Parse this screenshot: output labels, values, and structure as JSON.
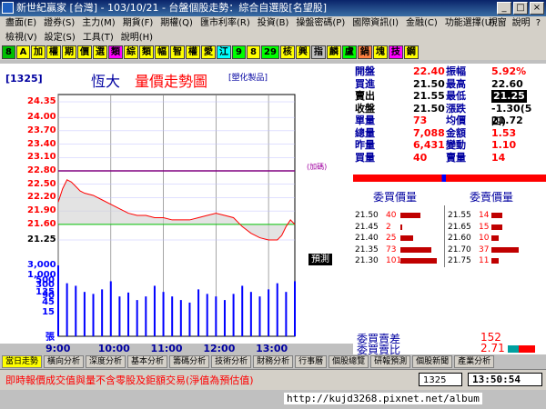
{
  "window": {
    "title": "新世紀贏家 [台灣] - 103/10/21 - 台盤個股走勢：綜合自選股[名望股]",
    "controls": [
      "_",
      "□",
      "×"
    ]
  },
  "menu": {
    "row1": [
      "盡面(E)",
      "證券(S)",
      "主力(M)",
      "期貨(F)",
      "期權(Q)",
      "匯市利率(R)",
      "投資(B)",
      "操盤密碼(P)",
      "國際資訊(I)",
      "金融(C)",
      "功能選擇(U)"
    ],
    "row2": [
      "檢視(V)",
      "設定(S)",
      "工具(T)",
      "說明(H)"
    ],
    "right_tools": [
      "視窗",
      "說明",
      "?"
    ]
  },
  "toolbar": {
    "buttons": [
      {
        "label": "8",
        "bg": "#00c000"
      },
      {
        "label": "A",
        "bg": "#ffff00"
      },
      {
        "label": "加",
        "bg": "#ffff00"
      },
      {
        "label": "權",
        "bg": "#ffff00"
      },
      {
        "label": "期",
        "bg": "#ffff00"
      },
      {
        "label": "價",
        "bg": "#ffff00"
      },
      {
        "label": "選",
        "bg": "#ffff00"
      },
      {
        "label": "類",
        "bg": "#ff00ff"
      },
      {
        "label": "綜",
        "bg": "#ffff00"
      },
      {
        "label": "類",
        "bg": "#ffff00"
      },
      {
        "label": "幅",
        "bg": "#ffff00"
      },
      {
        "label": "智",
        "bg": "#ffff00"
      },
      {
        "label": "權",
        "bg": "#ffff00"
      },
      {
        "label": "愛",
        "bg": "#ffff00"
      },
      {
        "label": "江",
        "bg": "#00ffff"
      },
      {
        "label": "9",
        "bg": "#00ff00"
      },
      {
        "label": "8",
        "bg": "#ffff00"
      },
      {
        "label": "29",
        "bg": "#00ff00"
      },
      {
        "label": "核",
        "bg": "#ffff00"
      },
      {
        "label": "興",
        "bg": "#ffff00"
      },
      {
        "label": "指",
        "bg": "#c0c0c0"
      },
      {
        "label": "麟",
        "bg": "#ffff00"
      },
      {
        "label": "盧",
        "bg": "#00ff00"
      },
      {
        "label": "鍋",
        "bg": "#ff8040"
      },
      {
        "label": "塊",
        "bg": "#ffff00"
      },
      {
        "label": "技",
        "bg": "#ff00ff"
      },
      {
        "label": "鋼",
        "bg": "#ffff00"
      }
    ]
  },
  "chart_header": {
    "code": "[1325]",
    "stock_name": "恆大",
    "title": "量價走勢圖",
    "tag": "[塑化製品]",
    "limit_label": "(加碼)",
    "yuce_label": "預測"
  },
  "colors": {
    "price_line": "#ff0000",
    "volume_bar": "#0000ff",
    "limit_line": "#800080",
    "ref_line": "#00c000",
    "label_red": "#ff0000",
    "label_blue": "#0000ff"
  },
  "chart_data": {
    "type": "line",
    "price_ticks": [
      "24.35",
      "24.00",
      "23.70",
      "23.40",
      "23.10",
      "22.80",
      "22.50",
      "22.20",
      "21.90",
      "21.60",
      "21.25"
    ],
    "volume_ticks": [
      "3,000",
      "1,000",
      "500",
      "300",
      "135",
      "90",
      "45",
      "15",
      "張"
    ],
    "x_ticks": [
      "9:00",
      "10:00",
      "11:00",
      "12:00",
      "13:00"
    ],
    "ylim": [
      21.25,
      24.35
    ],
    "limit_price": 22.8,
    "ref_price": 21.6,
    "price_x": [
      "09:00",
      "09:05",
      "09:10",
      "09:15",
      "09:20",
      "09:25",
      "09:30",
      "09:40",
      "09:50",
      "10:00",
      "10:10",
      "10:20",
      "10:30",
      "10:40",
      "10:50",
      "11:00",
      "11:10",
      "11:20",
      "11:30",
      "11:40",
      "11:50",
      "12:00",
      "12:10",
      "12:20",
      "12:30",
      "12:40",
      "12:50",
      "13:00",
      "13:10",
      "13:15",
      "13:20",
      "13:25",
      "13:30"
    ],
    "price_y": [
      22.1,
      22.4,
      22.6,
      22.55,
      22.45,
      22.35,
      22.3,
      22.25,
      22.15,
      22.05,
      21.95,
      21.85,
      21.8,
      21.8,
      21.75,
      21.75,
      21.7,
      21.7,
      21.7,
      21.75,
      21.8,
      21.85,
      21.8,
      21.75,
      21.55,
      21.4,
      21.3,
      21.25,
      21.25,
      21.35,
      21.55,
      21.7,
      21.6
    ],
    "volume_x": [
      "09:00",
      "09:10",
      "09:20",
      "09:30",
      "09:40",
      "09:50",
      "10:00",
      "10:10",
      "10:20",
      "10:30",
      "10:40",
      "10:50",
      "11:00",
      "11:10",
      "11:20",
      "11:30",
      "11:40",
      "11:50",
      "12:00",
      "12:10",
      "12:20",
      "12:30",
      "12:40",
      "12:50",
      "13:00",
      "13:10",
      "13:20",
      "13:30"
    ],
    "volume_y": [
      3000,
      400,
      300,
      150,
      120,
      200,
      500,
      90,
      140,
      60,
      90,
      300,
      150,
      90,
      60,
      45,
      200,
      120,
      90,
      60,
      120,
      300,
      150,
      90,
      200,
      400,
      150,
      500
    ]
  },
  "quote": {
    "rows": [
      {
        "l_label": "開盤",
        "l_val": "22.40",
        "l_color": "#ff0000",
        "r_label": "振幅",
        "r_val": "5.92%",
        "r_color": "#ff0000"
      },
      {
        "l_label": "買進",
        "l_val": "21.50",
        "l_color": "#000000",
        "r_label": "最高",
        "r_val": "22.60",
        "r_color": "#000000"
      },
      {
        "l_label": "賣出",
        "l_val": "21.55",
        "l_color": "#000000",
        "r_label": "最低",
        "r_val": "21.25",
        "r_color": "#ffffff"
      },
      {
        "l_label": "收盤",
        "l_val": "21.50",
        "l_color": "#000000",
        "r_label": "漲跌",
        "r_val": "-1.30(5四)",
        "r_color": "#000000"
      },
      {
        "l_label": "單量",
        "l_val": "73",
        "l_color": "#ff0000",
        "r_label": "均價",
        "r_val": "21.72",
        "r_color": "#000000"
      },
      {
        "l_label": "總量",
        "l_val": "7,088",
        "l_color": "#ff0000",
        "r_label": "金額",
        "r_val": "1.53",
        "r_color": "#ff0000"
      },
      {
        "l_label": "昨量",
        "l_val": "6,431",
        "l_color": "#ff0000",
        "r_label": "變動",
        "r_val": "1.10",
        "r_color": "#ff0000"
      },
      {
        "l_label": "買量",
        "l_val": "40",
        "l_color": "#ff0000",
        "r_label": "賣量",
        "r_val": "14",
        "r_color": "#ff0000"
      }
    ]
  },
  "orderbook": {
    "buy_header": "委買價量",
    "sell_header": "委賣價量",
    "buy": [
      {
        "price": "21.50",
        "qty": "40",
        "frac": 0.55
      },
      {
        "price": "21.45",
        "qty": "2",
        "frac": 0.05
      },
      {
        "price": "21.40",
        "qty": "25",
        "frac": 0.35
      },
      {
        "price": "21.35",
        "qty": "73",
        "frac": 0.85
      },
      {
        "price": "21.30",
        "qty": "101",
        "frac": 1.0
      }
    ],
    "sell": [
      {
        "price": "21.55",
        "qty": "14",
        "frac": 0.3
      },
      {
        "price": "21.65",
        "qty": "15",
        "frac": 0.3
      },
      {
        "price": "21.60",
        "qty": "10",
        "frac": 0.2
      },
      {
        "price": "21.70",
        "qty": "37",
        "frac": 0.75
      },
      {
        "price": "21.75",
        "qty": "11",
        "frac": 0.2
      }
    ],
    "diff_label": "委買賣差",
    "diff_value": "152",
    "ratio_label": "委買賣比",
    "ratio_value": "2.71"
  },
  "bottom_tabs": [
    "當日走勢",
    "橫向分析",
    "深度分析",
    "基本分析",
    "籌碼分析",
    "技術分析",
    "財務分析",
    "行事曆",
    "個股總覽",
    "研報預測",
    "個股新聞",
    "產業分析"
  ],
  "status": {
    "message": "即時報價成交值與量不含零股及鉅額交易(淨值為預估值)",
    "code": "1325",
    "clock": "13:50:54"
  },
  "watermark": "http://kujd3268.pixnet.net/album"
}
